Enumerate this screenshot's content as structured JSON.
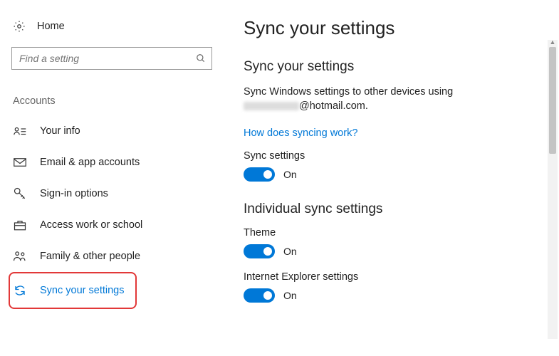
{
  "sidebar": {
    "home": "Home",
    "search_placeholder": "Find a setting",
    "section": "Accounts",
    "items": [
      {
        "label": "Your info"
      },
      {
        "label": "Email & app accounts"
      },
      {
        "label": "Sign-in options"
      },
      {
        "label": "Access work or school"
      },
      {
        "label": "Family & other people"
      },
      {
        "label": "Sync your settings"
      }
    ]
  },
  "main": {
    "page_title": "Sync your settings",
    "section1_heading": "Sync your settings",
    "desc_prefix": "Sync Windows settings to other devices using",
    "desc_suffix": "@hotmail.com.",
    "link": "How does syncing work?",
    "sync_settings_label": "Sync settings",
    "on_text": "On",
    "section2_heading": "Individual sync settings",
    "theme_label": "Theme",
    "ie_label": "Internet Explorer settings"
  }
}
